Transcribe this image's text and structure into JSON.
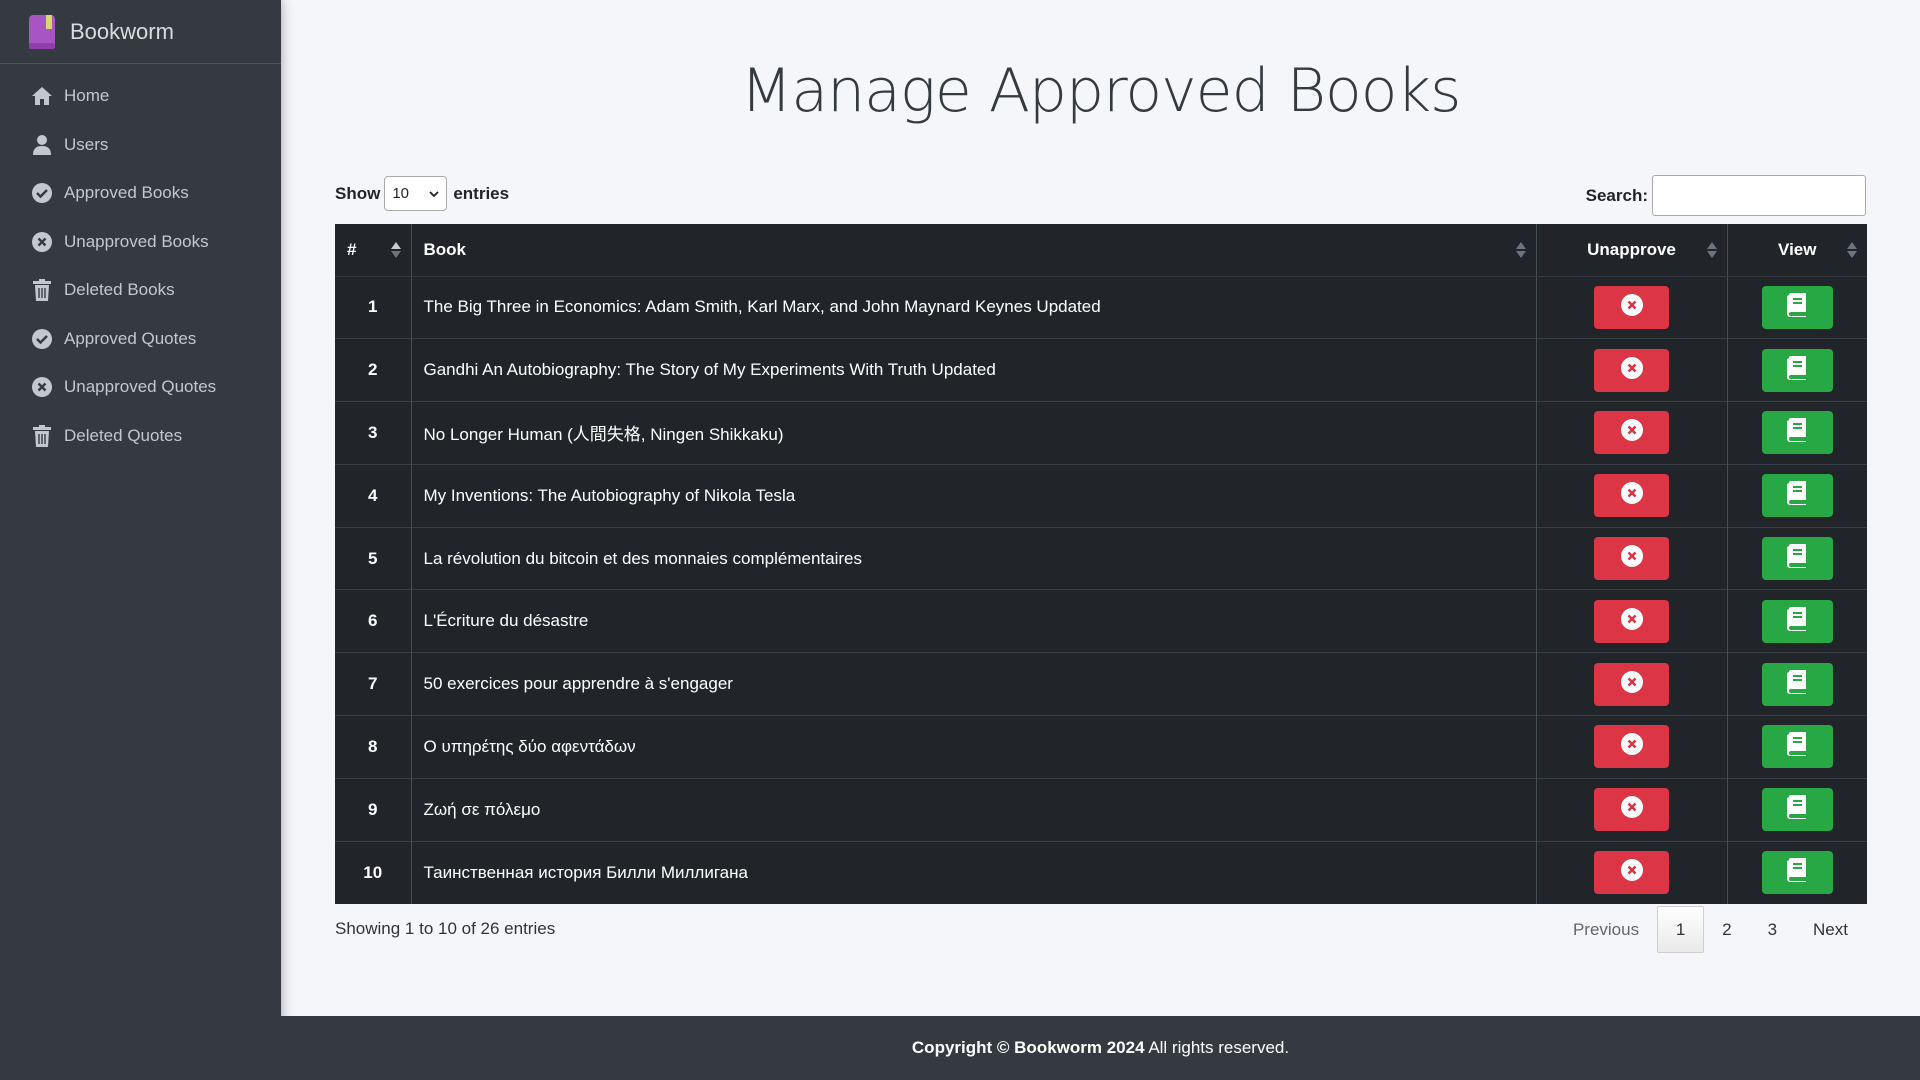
{
  "brand": {
    "name": "Bookworm",
    "accent": "#a855c4"
  },
  "sidebar": {
    "items": [
      {
        "label": "Home",
        "icon": "home-icon"
      },
      {
        "label": "Users",
        "icon": "user-icon"
      },
      {
        "label": "Approved Books",
        "icon": "check-circle-icon"
      },
      {
        "label": "Unapproved Books",
        "icon": "x-circle-icon"
      },
      {
        "label": "Deleted Books",
        "icon": "trash-icon"
      },
      {
        "label": "Approved Quotes",
        "icon": "check-circle-icon"
      },
      {
        "label": "Unapproved Quotes",
        "icon": "x-circle-icon"
      },
      {
        "label": "Deleted Quotes",
        "icon": "trash-icon"
      }
    ]
  },
  "page": {
    "title": "Manage Approved Books"
  },
  "controls": {
    "show_label": "Show",
    "entries_value": "10",
    "entries_label": "entries",
    "search_label": "Search:",
    "search_value": ""
  },
  "table": {
    "headers": {
      "num": "#",
      "book": "Book",
      "unapprove": "Unapprove",
      "view": "View"
    },
    "rows": [
      {
        "num": "1",
        "book": "The Big Three in Economics: Adam Smith, Karl Marx, and John Maynard Keynes Updated"
      },
      {
        "num": "2",
        "book": "Gandhi An Autobiography: The Story of My Experiments With Truth Updated"
      },
      {
        "num": "3",
        "book": "No Longer Human (人間失格, Ningen Shikkaku)"
      },
      {
        "num": "4",
        "book": "My Inventions: The Autobiography of Nikola Tesla"
      },
      {
        "num": "5",
        "book": "La révolution du bitcoin et des monnaies complémentaires"
      },
      {
        "num": "6",
        "book": "L'Écriture du désastre"
      },
      {
        "num": "7",
        "book": "50 exercices pour apprendre à s'engager"
      },
      {
        "num": "8",
        "book": "Ο υπηρέτης δύο αφεντάδων"
      },
      {
        "num": "9",
        "book": "Ζωή σε πόλεμο"
      },
      {
        "num": "10",
        "book": "Таинственная история Билли Миллигана"
      }
    ]
  },
  "footer": {
    "copyright": "Copyright © Bookworm 2024",
    "rights": " All rights reserved."
  },
  "pagination": {
    "info": "Showing 1 to 10 of 26 entries",
    "previous": "Previous",
    "pages": [
      "1",
      "2",
      "3"
    ],
    "next": "Next"
  },
  "colors": {
    "danger": "#dc3545",
    "success": "#28a745",
    "sidebar": "#343a40",
    "table": "#212529"
  }
}
